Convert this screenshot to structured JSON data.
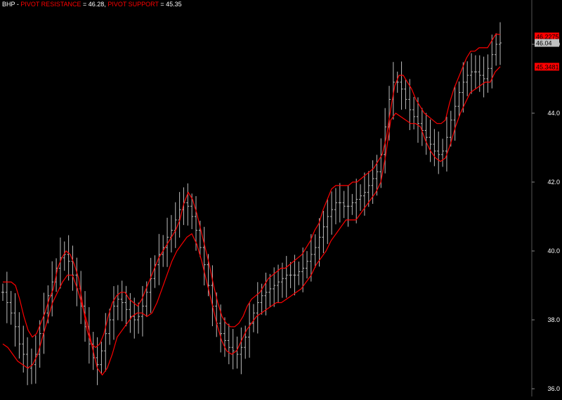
{
  "legend": {
    "symbol": "BHP",
    "sep1": " - ",
    "resistance_label": "PIVOT RESISTANCE",
    "resistance_value": " = 46.28, ",
    "support_label": "PIVOT SUPPORT",
    "support_value": " = 45.35"
  },
  "colors": {
    "background": "#000000",
    "band": "#ff0000",
    "bars": "#bdbdbd",
    "axis_text": "#ffffff",
    "last_price_box": "#c0c0c0"
  },
  "chart_data": {
    "type": "line",
    "title": "",
    "xlabel": "",
    "ylabel": "",
    "ylim": [
      36.0,
      46.4
    ],
    "y_ticks": [
      "36.0",
      "38.0",
      "40.0",
      "42.0",
      "44.0",
      "46.0"
    ],
    "grid": false,
    "legend_position": "top-left",
    "price_bars": {
      "name": "BHP",
      "close": [
        38.8,
        38.5,
        38.2,
        37.8,
        37.3,
        37.0,
        36.6,
        36.7,
        37.0,
        37.6,
        38.2,
        38.7,
        39.1,
        39.5,
        39.8,
        39.9,
        39.7,
        39.3,
        38.9,
        38.4,
        37.8,
        37.3,
        36.9,
        36.7,
        37.1,
        37.6,
        38.0,
        38.4,
        38.6,
        38.5,
        38.3,
        38.1,
        38.0,
        38.1,
        38.4,
        38.8,
        39.2,
        39.6,
        39.9,
        40.1,
        40.4,
        40.6,
        40.9,
        41.2,
        41.4,
        41.3,
        41.0,
        40.6,
        40.1,
        39.6,
        39.0,
        38.4,
        37.9,
        37.6,
        37.4,
        37.2,
        37.1,
        37.0,
        37.2,
        37.5,
        37.9,
        38.2,
        38.5,
        38.7,
        38.8,
        38.9,
        39.0,
        39.1,
        39.2,
        39.3,
        39.3,
        39.3,
        39.4,
        39.5,
        39.7,
        39.9,
        40.1,
        40.4,
        40.7,
        41.0,
        41.2,
        41.4,
        41.4,
        41.3,
        41.3,
        41.4,
        41.5,
        41.6,
        41.7,
        41.9,
        42.1,
        42.3,
        42.8,
        43.6,
        44.4,
        44.9,
        44.9,
        44.7,
        44.4,
        44.1,
        43.9,
        43.7,
        43.5,
        43.3,
        43.1,
        42.9,
        42.8,
        42.9,
        43.3,
        43.8,
        44.2,
        44.6,
        44.9,
        45.1,
        45.2,
        45.2,
        45.1,
        45.0,
        45.3,
        45.7,
        46.0,
        46.04
      ]
    },
    "series": [
      {
        "name": "PIVOT RESISTANCE",
        "values": [
          39.1,
          39.1,
          39.1,
          39.0,
          38.6,
          38.1,
          37.7,
          37.5,
          37.6,
          37.9,
          38.2,
          38.6,
          38.9,
          39.5,
          39.8,
          40.0,
          39.9,
          39.6,
          39.2,
          38.4,
          37.7,
          37.3,
          37.2,
          37.3,
          37.6,
          38.1,
          38.5,
          38.7,
          38.8,
          38.8,
          38.6,
          38.5,
          38.4,
          38.6,
          38.9,
          39.2,
          39.5,
          39.8,
          40.0,
          40.2,
          40.4,
          40.6,
          40.9,
          41.4,
          41.7,
          41.5,
          41.1,
          40.6,
          40.1,
          39.6,
          39.0,
          38.5,
          38.1,
          37.9,
          37.8,
          37.8,
          37.9,
          38.1,
          38.4,
          38.6,
          38.7,
          38.8,
          39.0,
          39.2,
          39.3,
          39.4,
          39.5,
          39.5,
          39.6,
          39.7,
          39.8,
          39.9,
          40.1,
          40.3,
          40.6,
          40.8,
          41.2,
          41.5,
          41.8,
          41.9,
          41.9,
          41.9,
          41.9,
          42.0,
          42.0,
          42.1,
          42.2,
          42.3,
          42.4,
          42.6,
          42.8,
          43.3,
          44.1,
          44.8,
          45.1,
          45.1,
          44.9,
          44.7,
          44.4,
          44.2,
          44.0,
          43.9,
          43.8,
          43.7,
          43.7,
          43.8,
          44.3,
          44.7,
          45.0,
          45.3,
          45.6,
          45.8,
          45.8,
          45.9,
          45.9,
          45.9,
          46.1,
          46.3,
          46.28
        ]
      },
      {
        "name": "PIVOT SUPPORT",
        "values": [
          37.3,
          37.2,
          37.0,
          36.8,
          36.7,
          36.6,
          36.7,
          37.0,
          37.5,
          38.0,
          38.5,
          38.8,
          39.1,
          39.3,
          39.3,
          38.9,
          38.4,
          37.9,
          37.2,
          36.6,
          36.4,
          36.6,
          37.0,
          37.5,
          37.7,
          37.9,
          38.1,
          38.2,
          38.2,
          38.1,
          38.2,
          38.5,
          38.9,
          39.3,
          39.7,
          40.0,
          40.2,
          40.4,
          40.5,
          40.2,
          39.7,
          39.1,
          38.5,
          37.9,
          37.4,
          37.1,
          37.0,
          37.1,
          37.4,
          37.7,
          37.9,
          38.1,
          38.2,
          38.3,
          38.4,
          38.5,
          38.5,
          38.6,
          38.7,
          38.8,
          38.9,
          39.1,
          39.3,
          39.6,
          39.8,
          40.0,
          40.3,
          40.5,
          40.7,
          40.9,
          40.9,
          40.9,
          41.1,
          41.3,
          41.5,
          41.7,
          42.0,
          42.8,
          43.8,
          44.0,
          43.9,
          43.8,
          43.7,
          43.7,
          43.6,
          43.2,
          42.9,
          42.7,
          42.6,
          42.7,
          43.1,
          43.6,
          44.0,
          44.3,
          44.6,
          44.7,
          44.8,
          44.9,
          44.9,
          45.2,
          45.35
        ]
      }
    ],
    "markers": [
      {
        "label": "46.2275",
        "value": 46.2275,
        "color": "#ff0000"
      },
      {
        "label": "46.04",
        "value": 46.04,
        "color": "#c0c0c0"
      },
      {
        "label": "45.3481",
        "value": 45.3481,
        "color": "#ff0000"
      }
    ]
  }
}
